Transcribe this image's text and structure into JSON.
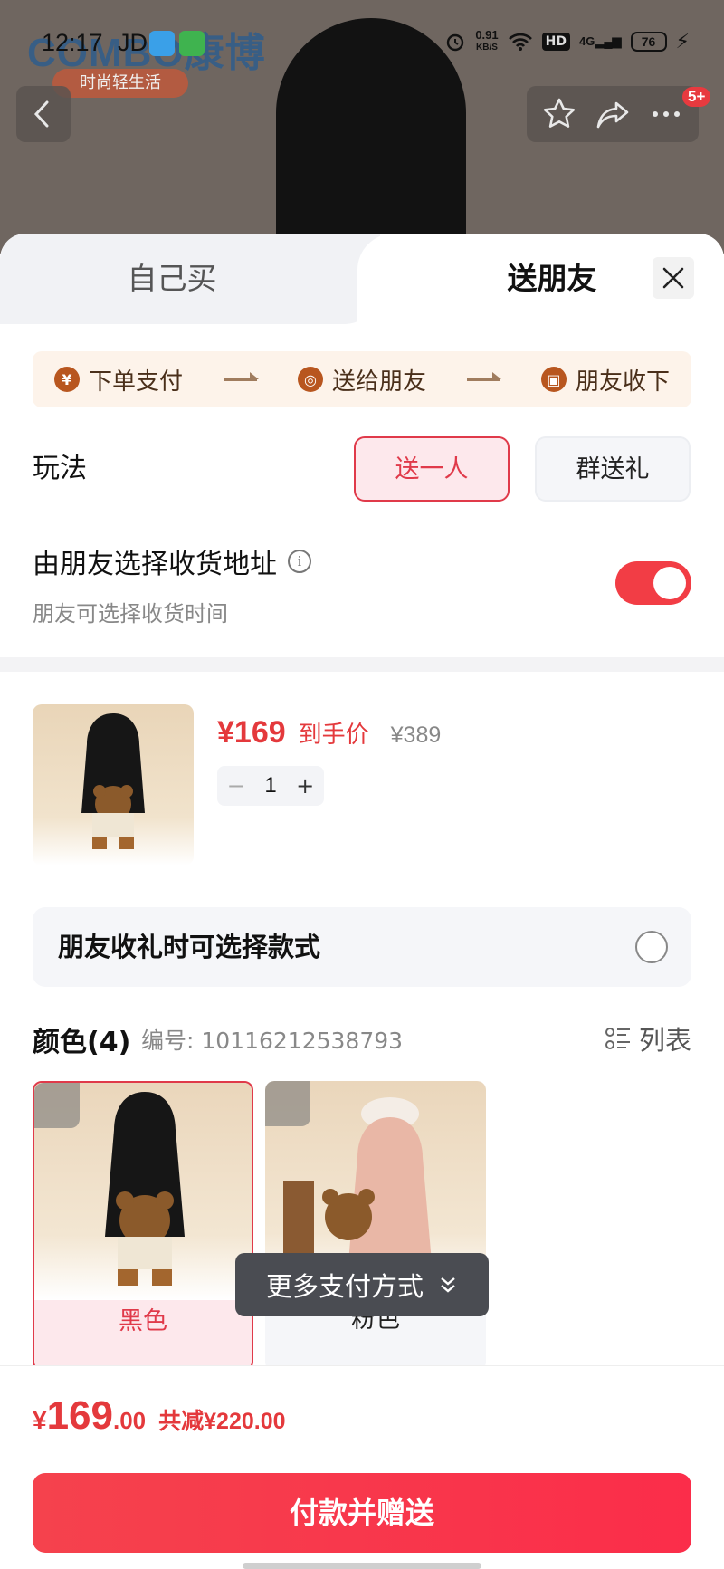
{
  "status_bar": {
    "time": "12:17",
    "carrier_text": "JD",
    "net_speed_value": "0.91",
    "net_speed_unit": "KB/S",
    "hd_label": "HD",
    "signal_label": "4G",
    "battery": "76"
  },
  "background": {
    "brand": "COMBO康博",
    "brand_tagline": "时尚轻生活"
  },
  "nav": {
    "badge": "5+",
    "icons": [
      "back-icon",
      "star-icon",
      "share-icon",
      "more-icon"
    ]
  },
  "tabs": {
    "self_buy": "自己买",
    "gift_friend": "送朋友"
  },
  "steps": [
    {
      "icon": "yen-icon",
      "glyph": "¥",
      "label": "下单支付"
    },
    {
      "icon": "wechat-icon",
      "glyph": "◎",
      "label": "送给朋友"
    },
    {
      "icon": "gift-icon",
      "glyph": "▣",
      "label": "朋友收下"
    }
  ],
  "mode": {
    "label": "玩法",
    "single": "送一人",
    "group": "群送礼"
  },
  "address": {
    "title": "由朋友选择收货地址",
    "info_glyph": "i",
    "subtitle": "朋友可选择收货时间",
    "toggle_on": true
  },
  "product": {
    "price": "¥169",
    "price_tag": "到手价",
    "original_price": "¥389",
    "quantity": "1",
    "minus": "−",
    "plus": "+"
  },
  "style_select": {
    "label": "朋友收礼时可选择款式"
  },
  "colors": {
    "title": "颜色(4)",
    "code": "编号: 10116212538793",
    "list_label": "列表",
    "options": [
      {
        "label": "黑色",
        "selected": true
      },
      {
        "label": "粉色",
        "selected": false
      }
    ]
  },
  "more_payment": {
    "label": "更多支付方式"
  },
  "footer": {
    "currency": "¥",
    "total_int": "169",
    "total_dec": ".00",
    "saving": "共减¥220.00",
    "pay_button": "付款并赠送"
  },
  "colors_theme": {
    "accent_red": "#e4393c",
    "toggle_red": "#f23d45",
    "step_bg": "#fdf3ea"
  }
}
